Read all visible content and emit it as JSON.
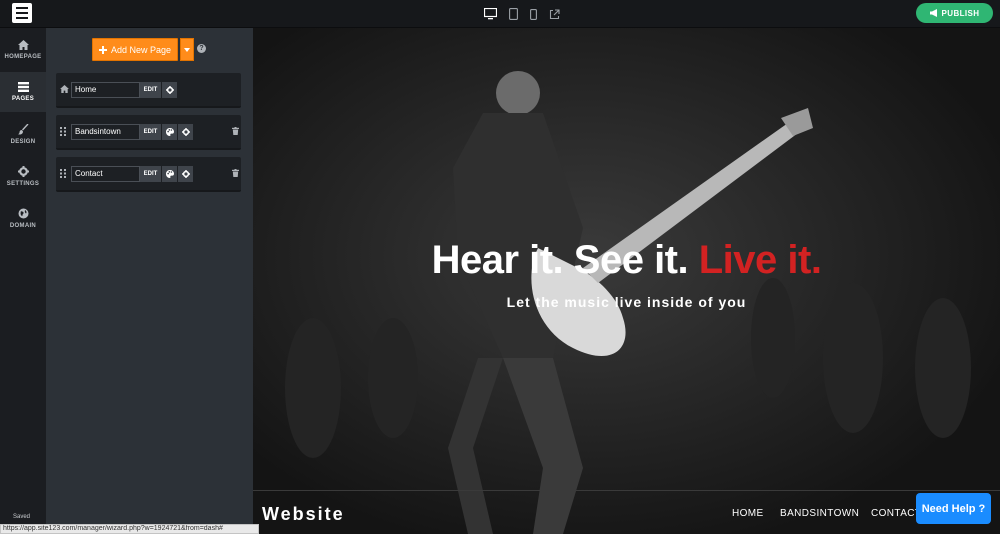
{
  "topbar": {
    "publish_label": "PUBLISH",
    "device_icons": [
      "desktop-icon",
      "tablet-icon",
      "mobile-icon",
      "external-link-icon"
    ]
  },
  "sidebar": {
    "items": [
      {
        "label": "HOMEPAGE",
        "icon": "home-icon"
      },
      {
        "label": "PAGES",
        "icon": "pages-icon"
      },
      {
        "label": "DESIGN",
        "icon": "brush-icon"
      },
      {
        "label": "SETTINGS",
        "icon": "gear-icon"
      },
      {
        "label": "DOMAIN",
        "icon": "globe-icon"
      }
    ],
    "active": "PAGES",
    "saved_label": "Saved"
  },
  "pages_panel": {
    "add_button_label": "Add New Page",
    "help_icon": "question-icon",
    "pages": [
      {
        "name": "Home",
        "edit_label": "EDIT",
        "lead_icon": "home-icon",
        "deletable": false
      },
      {
        "name": "Bandsintown",
        "edit_label": "EDIT",
        "lead_icon": "drag-handle-icon",
        "deletable": true
      },
      {
        "name": "Contact",
        "edit_label": "EDIT",
        "lead_icon": "drag-handle-icon",
        "deletable": true
      }
    ]
  },
  "preview": {
    "hero_title_white": "Hear it. See it. ",
    "hero_title_red": "Live it.",
    "hero_subtitle": "Let the music live inside of you",
    "brand": "Website",
    "menu": [
      "HOME",
      "BANDSINTOWN",
      "CONTACT"
    ],
    "need_help_label": "Need Help ?",
    "accent_red": "#d22222"
  },
  "status_url": "https://app.site123.com/manager/wizard.php?w=1924721&from=dash#",
  "colors": {
    "publish_green": "#2fb673",
    "add_orange": "#ff8c1a",
    "help_blue": "#1a8cff"
  }
}
